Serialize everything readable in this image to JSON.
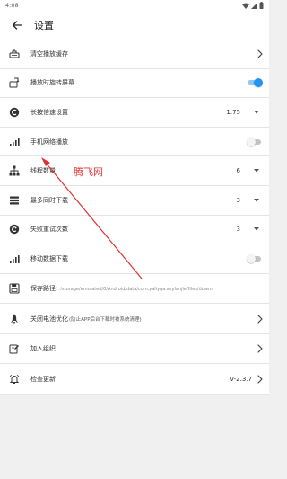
{
  "status_bar": {
    "time": "4:08"
  },
  "app_bar": {
    "title": "设置"
  },
  "settings": [
    {
      "key": "clear_cache",
      "icon": "broom-icon",
      "label": "清空播放缓存",
      "control": "chevron"
    },
    {
      "key": "rotate_screen",
      "icon": "screen-rotation-icon",
      "label": "播放时旋转屏幕",
      "control": "toggle",
      "value": true
    },
    {
      "key": "long_press_speed",
      "icon": "speed-c-icon",
      "label": "长按倍速设置",
      "control": "dropdown",
      "value": "1.75"
    },
    {
      "key": "mobile_play",
      "icon": "signal-bars-icon",
      "label": "手机网络播放",
      "control": "toggle",
      "value": false
    },
    {
      "key": "thread_count",
      "icon": "network-tree-icon",
      "label": "线程数量",
      "control": "dropdown",
      "value": "6"
    },
    {
      "key": "max_downloads",
      "icon": "download-list-icon",
      "label": "最多同时下载",
      "control": "dropdown",
      "value": "3"
    },
    {
      "key": "retry_count",
      "icon": "retry-c-icon",
      "label": "失败重试次数",
      "control": "dropdown",
      "value": "3"
    },
    {
      "key": "mobile_download",
      "icon": "signal-bars-icon",
      "label": "移动数据下载",
      "control": "toggle",
      "value": false
    },
    {
      "key": "save_path",
      "icon": "save-disk-icon",
      "label": "保存路径:",
      "sub": "/storage/emulated/0/Android/data/com.yaliyga.azylanjie/files/dowm",
      "control": "none"
    },
    {
      "key": "battery_opt",
      "icon": "rocket-icon",
      "label": "关闭电池优化",
      "note": "(防止APP后台下载时被系统清理)",
      "control": "chevron"
    },
    {
      "key": "join_group",
      "icon": "edit-note-icon",
      "label": "加入组织",
      "control": "chevron"
    },
    {
      "key": "check_update",
      "icon": "bell-update-icon",
      "label": "检查更新",
      "control": "chevron-value",
      "value": "V-2.3.7"
    }
  ],
  "watermark": {
    "text": "腾飞网"
  },
  "colors": {
    "accent": "#2196f3",
    "watermark": "#e33232",
    "arrow": "#e03030"
  }
}
